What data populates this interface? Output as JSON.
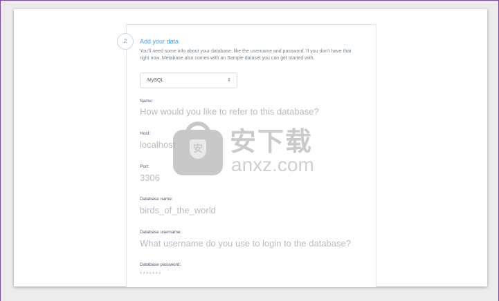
{
  "step": {
    "number": "2",
    "title": "Add your data",
    "description": "You'll need some info about your database, like the username and password. If you don't have that right now, Metabase also comes with an Sample dataset you can get started with."
  },
  "database_type": {
    "selected": "MySQL"
  },
  "fields": {
    "name": {
      "label": "Name:",
      "placeholder": "How would you like to refer to this database?"
    },
    "host": {
      "label": "Host:",
      "value": "localhost"
    },
    "port": {
      "label": "Port:",
      "value": "3306"
    },
    "database_name": {
      "label": "Database name:",
      "value": "birds_of_the_world"
    },
    "database_username": {
      "label": "Database username:",
      "placeholder": "What username do you use to login to the database?"
    },
    "database_password": {
      "label": "Database password:",
      "placeholder": "*******"
    }
  },
  "watermark": {
    "cn": "安下载",
    "en": "anxz.com",
    "shield": "安"
  },
  "colors": {
    "accent": "#509ee3",
    "label": "#4c5773",
    "placeholder": "#b8bbc3"
  },
  "icons": {
    "select_chevron": "chevron-up-down-icon"
  }
}
